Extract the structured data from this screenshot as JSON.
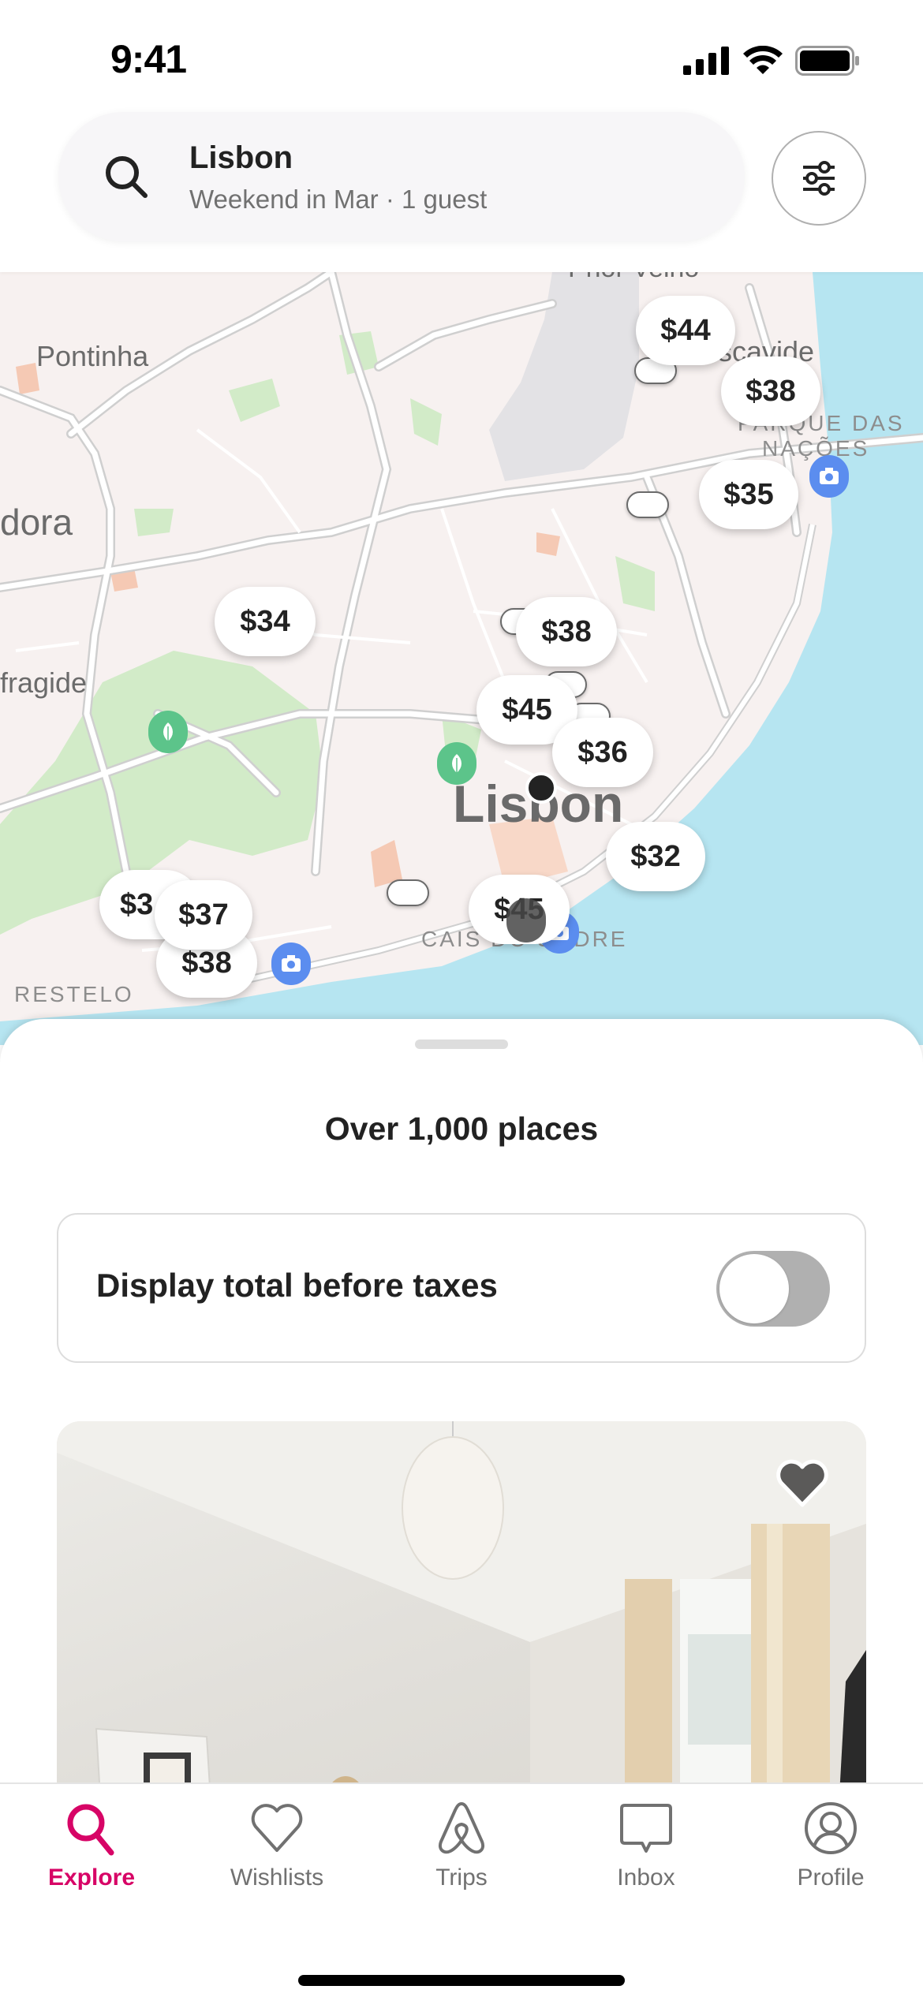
{
  "status_bar": {
    "time": "9:41",
    "icons": [
      "cellular-signal-icon",
      "wifi-icon",
      "battery-icon"
    ]
  },
  "search": {
    "icon": "search-icon",
    "location": "Lisbon",
    "details": "Weekend in Mar · 1 guest",
    "filter_icon": "sliders-icon"
  },
  "map": {
    "labels": {
      "pontinha": "Pontinha",
      "amadora": "dora",
      "alfragide": "fragide",
      "moscavide": "Moscavide",
      "parque_das_nacoes_1": "PARQUE DAS",
      "parque_das_nacoes_2": "NAÇÕES",
      "lisbon": "Lisbon",
      "restelo": "RESTELO",
      "cais": "CAIS DO SODRE",
      "top": "Prior Velho"
    },
    "price_pins": [
      {
        "label": "$44"
      },
      {
        "label": "$38"
      },
      {
        "label": "$35"
      },
      {
        "label": "$34"
      },
      {
        "label": "$38"
      },
      {
        "label": "$45"
      },
      {
        "label": "$36"
      },
      {
        "label": "$32"
      },
      {
        "label": "$3"
      },
      {
        "label": "$37"
      },
      {
        "label": "$38"
      },
      {
        "label": "$45"
      }
    ],
    "poi_icons": [
      "park-leaf-icon",
      "park-leaf-icon",
      "camera-icon",
      "camera-icon",
      "camera-icon"
    ],
    "colors": {
      "land": "#f7f1f0",
      "water": "#b6e5f1",
      "park": "#d2ebc8",
      "road": "#ffffff",
      "road_outline": "#cfcfcf",
      "urban": "#f5c9b4",
      "airport": "#e3e2e5"
    }
  },
  "sheet": {
    "title": "Over 1,000 places",
    "tax_toggle_label": "Display total before taxes",
    "tax_toggle_on": false,
    "wishlist_icon": "heart-icon"
  },
  "tab_bar": {
    "active_color": "#d70466",
    "inactive_color": "#717171",
    "tabs": [
      {
        "label": "Explore",
        "icon": "search-icon",
        "active": true
      },
      {
        "label": "Wishlists",
        "icon": "heart-icon",
        "active": false
      },
      {
        "label": "Trips",
        "icon": "airbnb-logo-icon",
        "active": false
      },
      {
        "label": "Inbox",
        "icon": "message-bubble-icon",
        "active": false
      },
      {
        "label": "Profile",
        "icon": "user-circle-icon",
        "active": false
      }
    ]
  }
}
